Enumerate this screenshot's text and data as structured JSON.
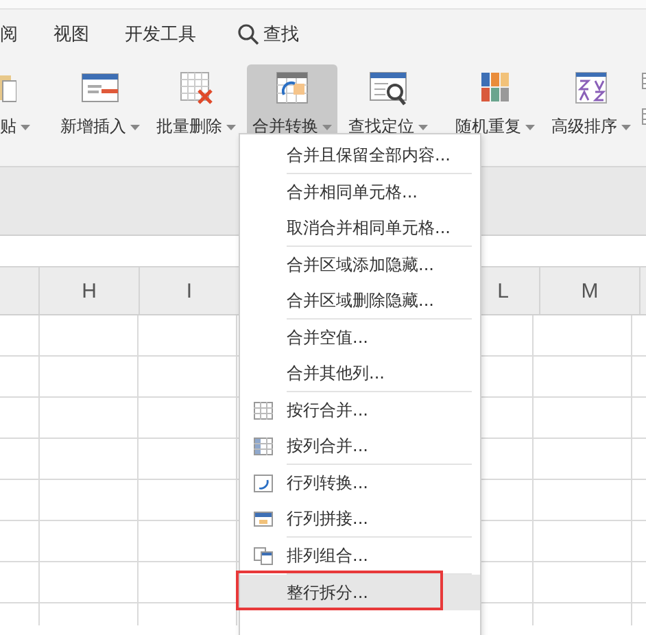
{
  "tabs": [
    {
      "label": "阅",
      "selected": false
    },
    {
      "label": "视图",
      "selected": false
    },
    {
      "label": "开发工具",
      "selected": false
    }
  ],
  "search": {
    "label": "查找"
  },
  "ribbon": {
    "buttons": [
      {
        "label": "贴",
        "selected": false
      },
      {
        "label": "新增插入",
        "selected": false
      },
      {
        "label": "批量删除",
        "selected": false
      },
      {
        "label": "合并转换",
        "selected": true
      },
      {
        "label": "查找定位",
        "selected": false
      },
      {
        "label": "随机重复",
        "selected": false
      },
      {
        "label": "高级排序",
        "selected": false
      }
    ]
  },
  "sheet": {
    "columns": [
      "",
      "H",
      "I",
      "",
      "",
      "L",
      "M",
      ""
    ]
  },
  "menu": {
    "groups": [
      {
        "items": [
          {
            "label": "合并且保留全部内容...",
            "hovered": false,
            "framed": false
          }
        ]
      },
      {
        "items": [
          {
            "label": "合并相同单元格...",
            "hovered": false,
            "framed": false
          },
          {
            "label": "取消合并相同单元格...",
            "hovered": false,
            "framed": false
          }
        ]
      },
      {
        "items": [
          {
            "label": "合并区域添加隐藏...",
            "hovered": false,
            "framed": false
          },
          {
            "label": "合并区域删除隐藏...",
            "hovered": false,
            "framed": false
          }
        ]
      },
      {
        "items": [
          {
            "label": "合并空值...",
            "hovered": false,
            "framed": false
          },
          {
            "label": "合并其他列...",
            "hovered": false,
            "framed": false
          }
        ]
      },
      {
        "items": [
          {
            "label": "按行合并...",
            "hovered": false,
            "framed": false
          },
          {
            "label": "按列合并...",
            "hovered": false,
            "framed": false
          }
        ]
      },
      {
        "items": [
          {
            "label": "行列转换...",
            "hovered": false,
            "framed": false
          },
          {
            "label": "行列拼接...",
            "hovered": false,
            "framed": false
          }
        ]
      },
      {
        "items": [
          {
            "label": "排列组合...",
            "hovered": false,
            "framed": false
          }
        ]
      },
      {
        "items": [
          {
            "label": "整行拆分...",
            "hovered": true,
            "framed": true
          }
        ]
      }
    ]
  }
}
